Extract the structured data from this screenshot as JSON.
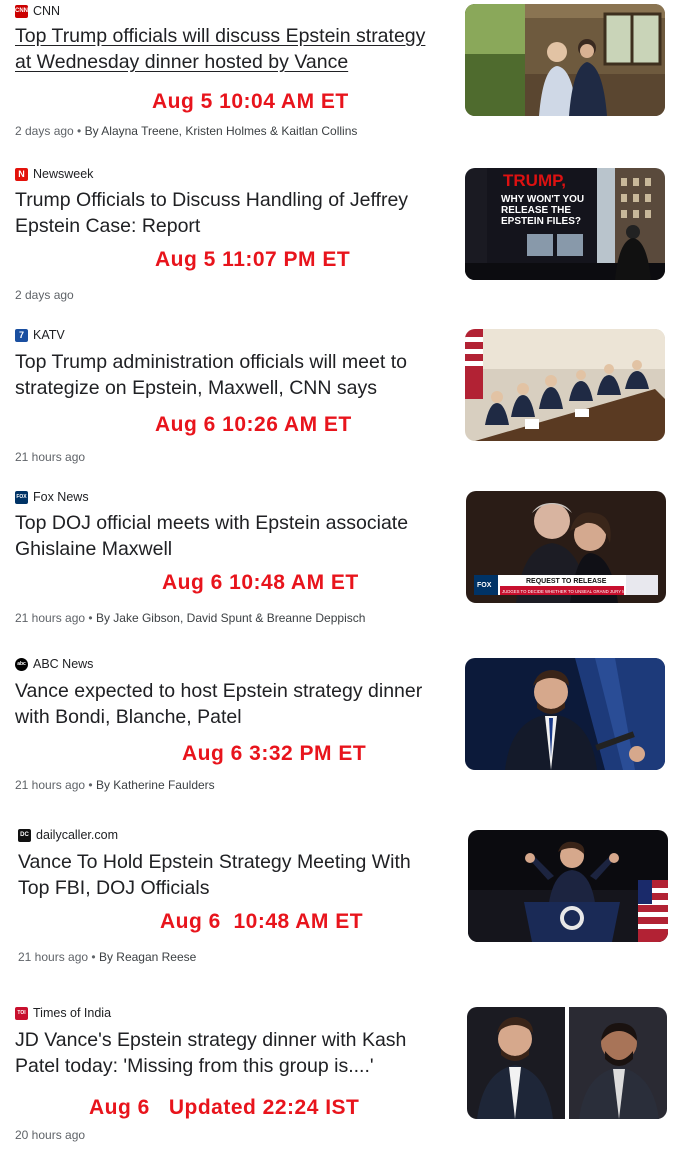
{
  "articles": [
    {
      "source": "CNN",
      "logo_text": "CNN",
      "logo_color": "#cc0000",
      "headline_line1": "Top Trump officials will discuss Epstein strategy",
      "headline_line2": "at Wednesday dinner hosted by Vance",
      "stamp": "Aug 5 10:04 AM ET",
      "age": "2 days ago",
      "byline": "By Alayna Treene, Kristen Holmes & Kaitlan Collins",
      "thumbnail_icon": "photo-two-people-on-porch"
    },
    {
      "source": "Newsweek",
      "logo_text": "N",
      "logo_color": "#e3120b",
      "headline_line1": "Trump Officials to Discuss Handling of Jeffrey",
      "headline_line2": "Epstein Case: Report",
      "stamp": "Aug 5 11:07 PM ET",
      "age": "2 days ago",
      "byline": "",
      "billboard_top": "TRUMP,",
      "billboard_text": [
        "WHY WON'T YOU",
        "RELEASE THE",
        "EPSTEIN FILES?"
      ],
      "thumbnail_icon": "photo-billboard"
    },
    {
      "source": "KATV",
      "logo_text": "7",
      "logo_color": "#1a4fa0",
      "headline_line1": "Top Trump administration officials will meet to",
      "headline_line2": "strategize on Epstein, Maxwell, CNN says",
      "stamp": "Aug 6 10:26 AM ET",
      "age": "21 hours ago",
      "byline": "",
      "thumbnail_icon": "photo-cabinet-meeting"
    },
    {
      "source": "Fox News",
      "logo_text": "FOX",
      "logo_color": "#003366",
      "headline_line1": "Top DOJ official meets with Epstein associate",
      "headline_line2": "Ghislaine Maxwell",
      "stamp": "Aug 6 10:48 AM ET",
      "age": "21 hours ago",
      "byline": "By Jake Gibson, David Spunt & Breanne Deppisch",
      "chyron_title": "REQUEST TO RELEASE",
      "chyron_sub": "JUDGES TO DECIDE WHETHER TO UNSEAL GRAND JURY MATERIAL",
      "thumbnail_icon": "photo-tv-screenshot"
    },
    {
      "source": "ABC News",
      "logo_text": "abc",
      "logo_color": "#000000",
      "headline_line1": "Vance expected to host Epstein strategy dinner",
      "headline_line2": "with Bondi, Blanche, Patel",
      "stamp": "Aug 6 3:32 PM ET",
      "age": "21 hours ago",
      "byline": "By Katherine Faulders",
      "thumbnail_icon": "photo-speaker-at-podium"
    },
    {
      "source": "dailycaller.com",
      "logo_text": "DC",
      "logo_color": "#111111",
      "headline_line1": "Vance To Hold Epstein Strategy Meeting With",
      "headline_line2": "Top FBI, DOJ Officials",
      "stamp": "Aug 6  10:48 AM ET",
      "age": "21 hours ago",
      "byline": "By Reagan Reese",
      "thumbnail_icon": "photo-speaker-with-flag"
    },
    {
      "source": "Times of India",
      "logo_text": "TOI",
      "logo_color": "#c8102e",
      "headline_line1": "JD Vance's Epstein strategy dinner with Kash",
      "headline_line2": "Patel today: 'Missing from this group is....'",
      "stamp": "Aug 6   Updated 22:24 IST",
      "age": "20 hours ago",
      "byline": "",
      "thumbnail_icon": "photo-two-portraits"
    }
  ]
}
